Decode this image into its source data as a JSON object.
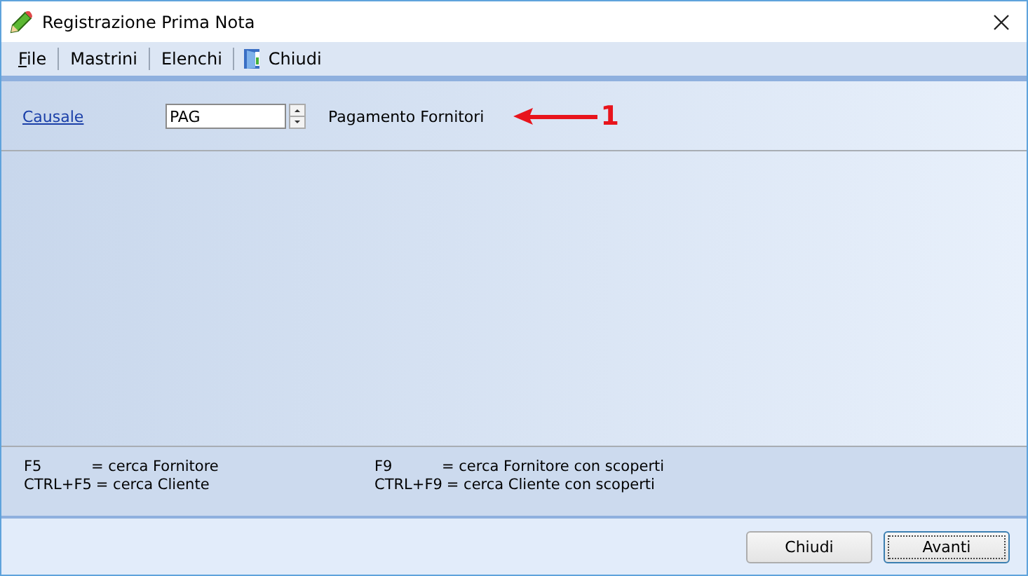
{
  "window": {
    "title": "Registrazione Prima Nota"
  },
  "menu": [
    {
      "label": "File",
      "kind": "text"
    },
    {
      "label": "Mastrini",
      "kind": "text"
    },
    {
      "label": "Elenchi",
      "kind": "text"
    },
    {
      "label": "Chiudi",
      "kind": "icon"
    }
  ],
  "causale": {
    "label": "Causale",
    "value": "PAG",
    "description": "Pagamento Fornitori"
  },
  "annotation": {
    "label": "1"
  },
  "help": [
    [
      {
        "key": "F5",
        "description": "= cerca Fornitore"
      },
      {
        "key": "CTRL+F5",
        "description": "= cerca Cliente"
      }
    ],
    [
      {
        "key": "F9",
        "description": "= cerca Fornitore con scoperti"
      },
      {
        "key": "CTRL+F9",
        "description": "= cerca Cliente con scoperti"
      }
    ]
  ],
  "buttons": [
    {
      "label": "Chiudi",
      "focused": false
    },
    {
      "label": "Avanti",
      "focused": true
    }
  ]
}
